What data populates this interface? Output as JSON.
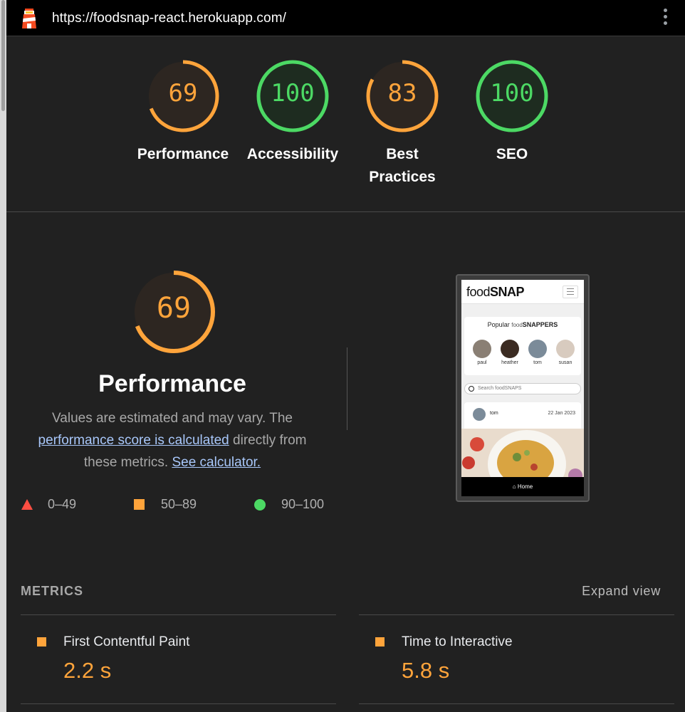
{
  "browser": {
    "url": "https://foodsnap-react.herokuapp.com/"
  },
  "colors": {
    "orange": "#ffa43b",
    "green": "#4cd964",
    "red": "#ff4e42",
    "bg": "#212121"
  },
  "scores": [
    {
      "value": "69",
      "label": "Performance",
      "score": 69,
      "status": "average"
    },
    {
      "value": "100",
      "label": "Accessibility",
      "score": 100,
      "status": "pass"
    },
    {
      "value": "83",
      "label": "Best Practices",
      "score": 83,
      "status": "average"
    },
    {
      "value": "100",
      "label": "SEO",
      "score": 100,
      "status": "pass"
    }
  ],
  "performance": {
    "score": "69",
    "title": "Performance",
    "desc_1": "Values are estimated and may vary. The",
    "link_score": "performance score is calculated",
    "desc_2": "directly from these metrics.",
    "link_calc": "See calculator."
  },
  "legend": [
    {
      "shape": "triangle",
      "range": "0–49"
    },
    {
      "shape": "square",
      "range": "50–89"
    },
    {
      "shape": "circle",
      "range": "90–100"
    }
  ],
  "preview": {
    "logo_light": "food",
    "logo_bold": "SNAP",
    "popular_prefix": "Popular",
    "popular_light": "food",
    "popular_bold": "SNAPPERS",
    "users": [
      "paul",
      "heather",
      "tom",
      "susan"
    ],
    "search_placeholder": "Search foodSNAPS",
    "post_user": "tom",
    "post_date": "22 Jan 2023",
    "nav_label": "Home"
  },
  "metrics": {
    "heading": "METRICS",
    "expand": "Expand view",
    "items": [
      {
        "name": "First Contentful Paint",
        "value": "2.2 s"
      },
      {
        "name": "Time to Interactive",
        "value": "5.8 s"
      }
    ]
  }
}
